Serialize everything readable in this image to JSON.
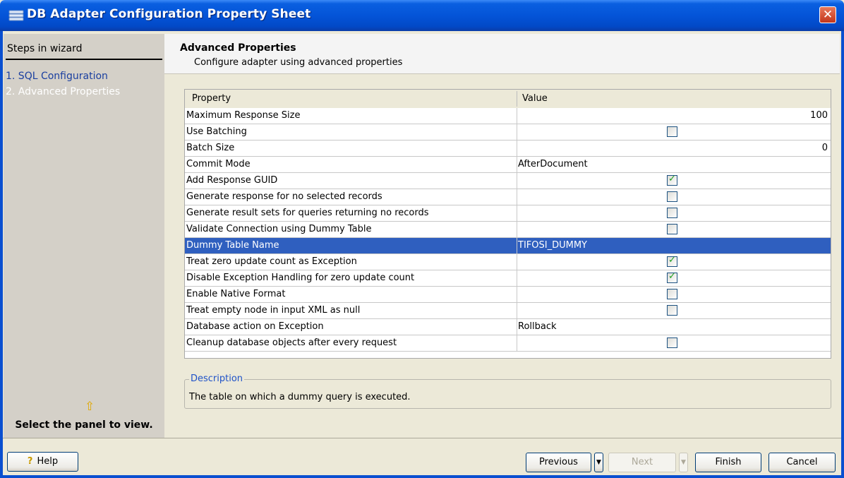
{
  "window": {
    "title": "DB Adapter Configuration Property Sheet",
    "close_glyph": "✕"
  },
  "sidebar": {
    "title": "Steps in wizard",
    "steps": [
      {
        "label": "1. SQL Configuration"
      },
      {
        "label": "2. Advanced Properties"
      }
    ],
    "hint_arrow": "⇧",
    "hint": "Select the panel to view."
  },
  "main": {
    "title": "Advanced Properties",
    "subtitle": "Configure adapter using advanced properties"
  },
  "table": {
    "headers": {
      "property": "Property",
      "value": "Value"
    },
    "rows": [
      {
        "name": "Maximum Response Size",
        "value": "100"
      },
      {
        "name": "Use Batching",
        "checked": false
      },
      {
        "name": "Batch Size",
        "value": "0"
      },
      {
        "name": "Commit Mode",
        "value": "AfterDocument"
      },
      {
        "name": "Add Response GUID",
        "checked": true
      },
      {
        "name": "Generate response for no selected records",
        "checked": false
      },
      {
        "name": "Generate result sets for queries returning no records",
        "checked": false
      },
      {
        "name": "Validate Connection using Dummy Table",
        "checked": false
      },
      {
        "name": "Dummy Table Name",
        "value": "TIFOSI_DUMMY",
        "selected": true
      },
      {
        "name": "Treat zero update count as Exception",
        "checked": true
      },
      {
        "name": "Disable Exception Handling for zero update count",
        "checked": true
      },
      {
        "name": "Enable Native Format",
        "checked": false
      },
      {
        "name": "Treat empty node in input XML as null",
        "checked": false
      },
      {
        "name": "Database action on Exception",
        "value": "Rollback"
      },
      {
        "name": "Cleanup database objects after every request",
        "checked": false
      }
    ]
  },
  "description": {
    "legend": "Description",
    "text": "The table on which a dummy query is executed."
  },
  "buttons": {
    "help": "Help",
    "previous": "Previous",
    "next": "Next",
    "finish": "Finish",
    "cancel": "Cancel"
  },
  "colors": {
    "titlebar": "#0454d8",
    "selection": "#2f5fbf",
    "link": "#1a3fa0"
  }
}
